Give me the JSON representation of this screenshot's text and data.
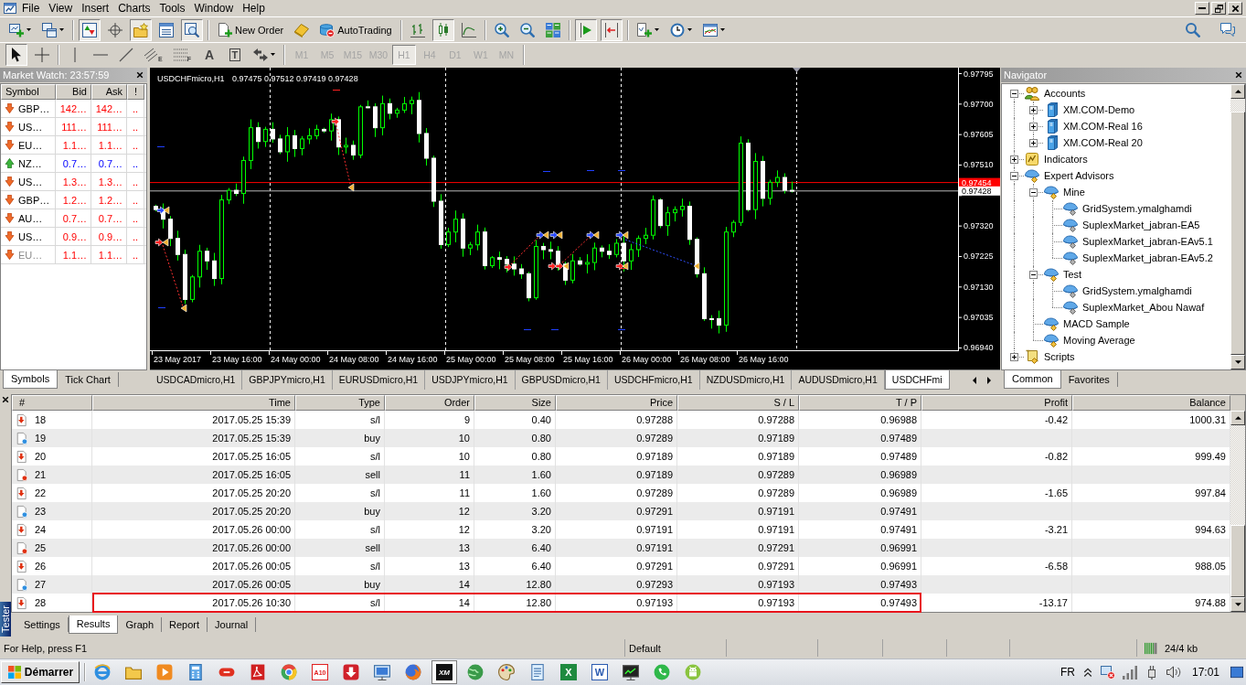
{
  "menu_bar": {
    "items": [
      "File",
      "View",
      "Insert",
      "Charts",
      "Tools",
      "Window",
      "Help"
    ]
  },
  "toolbar": {
    "groups": [
      [
        {
          "kind": "new-chart",
          "pressed": false
        },
        {
          "kind": "profiles",
          "pressed": false
        }
      ],
      [
        {
          "kind": "market-watch",
          "pressed": true
        },
        {
          "kind": "data-window",
          "pressed": false
        },
        {
          "kind": "navigator",
          "pressed": true
        },
        {
          "kind": "terminal",
          "pressed": false
        },
        {
          "kind": "tester",
          "pressed": true
        }
      ],
      [
        {
          "kind": "new-order",
          "label": "New Order",
          "pressed": false
        },
        {
          "kind": "editor",
          "pressed": false
        },
        {
          "kind": "autotrading",
          "label": "AutoTrading",
          "pressed": false
        }
      ],
      [
        {
          "kind": "bar-chart",
          "pressed": false
        },
        {
          "kind": "candle-chart",
          "pressed": true
        },
        {
          "kind": "line-chart",
          "pressed": false
        }
      ],
      [
        {
          "kind": "zoom-in",
          "pressed": false
        },
        {
          "kind": "zoom-out",
          "pressed": false
        },
        {
          "kind": "tile",
          "pressed": false
        }
      ],
      [
        {
          "kind": "auto-scroll",
          "pressed": true
        },
        {
          "kind": "chart-shift",
          "pressed": true
        }
      ],
      [
        {
          "kind": "indicators",
          "pressed": false
        },
        {
          "kind": "periods",
          "pressed": false
        },
        {
          "kind": "templates",
          "pressed": false
        }
      ]
    ]
  },
  "drawing_toolbar": {
    "tool_groups": [
      [
        {
          "kind": "cursor",
          "selected": true
        },
        {
          "kind": "crosshair",
          "selected": false
        }
      ],
      [
        {
          "kind": "vline",
          "selected": false
        },
        {
          "kind": "hline",
          "selected": false
        },
        {
          "kind": "trendline",
          "selected": false
        },
        {
          "kind": "channel",
          "mark": "E",
          "selected": false
        },
        {
          "kind": "fibo",
          "mark": "F",
          "selected": false
        },
        {
          "kind": "text",
          "label": "A",
          "selected": false
        },
        {
          "kind": "label",
          "label": "T",
          "selected": false
        },
        {
          "kind": "arrows",
          "selected": false
        }
      ]
    ],
    "timeframes": [
      {
        "label": "M1",
        "selected": false,
        "disabled": true
      },
      {
        "label": "M5",
        "selected": false,
        "disabled": true
      },
      {
        "label": "M15",
        "selected": false,
        "disabled": true
      },
      {
        "label": "M30",
        "selected": false,
        "disabled": true
      },
      {
        "label": "H1",
        "selected": true,
        "disabled": true
      },
      {
        "label": "H4",
        "selected": false,
        "disabled": true
      },
      {
        "label": "D1",
        "selected": false,
        "disabled": true
      },
      {
        "label": "W1",
        "selected": false,
        "disabled": true
      },
      {
        "label": "MN",
        "selected": false,
        "disabled": true
      }
    ]
  },
  "market_watch": {
    "title": "Market Watch: 23:57:59",
    "columns": [
      "Symbol",
      "Bid",
      "Ask",
      "!"
    ],
    "rows": [
      {
        "symbol": "GBP…",
        "bid": "142…",
        "ask": "142…",
        "extra": "..",
        "rising": false,
        "disabled": false
      },
      {
        "symbol": "US…",
        "bid": "111…",
        "ask": "111…",
        "extra": "..",
        "rising": false,
        "disabled": false
      },
      {
        "symbol": "EU…",
        "bid": "1.1…",
        "ask": "1.1…",
        "extra": "..",
        "rising": false,
        "disabled": false
      },
      {
        "symbol": "NZ…",
        "bid": "0.7…",
        "ask": "0.7…",
        "extra": "..",
        "rising": true,
        "disabled": false
      },
      {
        "symbol": "US…",
        "bid": "1.3…",
        "ask": "1.3…",
        "extra": "..",
        "rising": false,
        "disabled": false
      },
      {
        "symbol": "GBP…",
        "bid": "1.2…",
        "ask": "1.2…",
        "extra": "..",
        "rising": false,
        "disabled": false
      },
      {
        "symbol": "AU…",
        "bid": "0.7…",
        "ask": "0.7…",
        "extra": "..",
        "rising": false,
        "disabled": false
      },
      {
        "symbol": "US…",
        "bid": "0.9…",
        "ask": "0.9…",
        "extra": "..",
        "rising": false,
        "disabled": false
      },
      {
        "symbol": "EU…",
        "bid": "1.1…",
        "ask": "1.1…",
        "extra": "..",
        "rising": false,
        "disabled": true
      }
    ],
    "tabs": [
      {
        "label": "Symbols",
        "selected": true
      },
      {
        "label": "Tick Chart",
        "selected": false
      }
    ]
  },
  "chart": {
    "symbol": "USDCHFmicro,H1",
    "ohlc": "0.97475 0.97512 0.97419 0.97428",
    "price_scale": [
      "0.97795",
      "0.97700",
      "0.97605",
      "0.97510",
      "0.97320",
      "0.97225",
      "0.97130",
      "0.97035",
      "0.96940"
    ],
    "price_tags": [
      {
        "kind": "ask",
        "text": "0.97454"
      },
      {
        "kind": "bid",
        "text": "0.97428"
      }
    ],
    "time_scale": [
      "23 May 2017",
      "23 May 16:00",
      "24 May 00:00",
      "24 May 08:00",
      "24 May 16:00",
      "25 May 00:00",
      "25 May 08:00",
      "25 May 16:00",
      "26 May 00:00",
      "26 May 08:00",
      "26 May 16:00"
    ],
    "tabs": [
      {
        "label": "USDCADmicro,H1",
        "selected": false
      },
      {
        "label": "GBPJPYmicro,H1",
        "selected": false
      },
      {
        "label": "EURUSDmicro,H1",
        "selected": false
      },
      {
        "label": "USDJPYmicro,H1",
        "selected": false
      },
      {
        "label": "GBPUSDmicro,H1",
        "selected": false
      },
      {
        "label": "USDCHFmicro,H1",
        "selected": false
      },
      {
        "label": "NZDUSDmicro,H1",
        "selected": false
      },
      {
        "label": "AUDUSDmicro,H1",
        "selected": false
      },
      {
        "label": "USDCHFmi",
        "selected": true
      }
    ]
  },
  "navigator": {
    "title": "Navigator",
    "tree": [
      {
        "label": "Accounts",
        "kind": "accounts",
        "expanded": true,
        "children": [
          {
            "label": "XM.COM-Demo",
            "kind": "server",
            "expanded": false
          },
          {
            "label": "XM.COM-Real 16",
            "kind": "server",
            "expanded": false
          },
          {
            "label": "XM.COM-Real 20",
            "kind": "server",
            "expanded": false
          }
        ]
      },
      {
        "label": "Indicators",
        "kind": "indicators",
        "expanded": false
      },
      {
        "label": "Expert Advisors",
        "kind": "expert",
        "expanded": true,
        "children": [
          {
            "label": "Mine",
            "kind": "expert",
            "expanded": true,
            "children": [
              {
                "label": "GridSystem.ymalghamdi",
                "kind": "expert-file"
              },
              {
                "label": "SuplexMarket_jabran-EA5",
                "kind": "expert-file"
              },
              {
                "label": "SuplexMarket_jabran-EAv5.1",
                "kind": "expert-file"
              },
              {
                "label": "SuplexMarket_jabran-EAv5.2",
                "kind": "expert-file"
              }
            ]
          },
          {
            "label": "Test",
            "kind": "expert",
            "expanded": true,
            "children": [
              {
                "label": "GridSystem.ymalghamdi",
                "kind": "expert-file"
              },
              {
                "label": "SuplexMarket_Abou Nawaf",
                "kind": "expert-file"
              }
            ]
          },
          {
            "label": "MACD Sample",
            "kind": "expert"
          },
          {
            "label": "Moving Average",
            "kind": "expert"
          }
        ]
      },
      {
        "label": "Scripts",
        "kind": "scripts",
        "expanded": false
      }
    ],
    "tabs": [
      {
        "label": "Common",
        "selected": true
      },
      {
        "label": "Favorites",
        "selected": false
      }
    ]
  },
  "tester": {
    "title": "Tester",
    "columns": [
      "#",
      "Time",
      "Type",
      "Order",
      "Size",
      "Price",
      "S / L",
      "T / P",
      "Profit",
      "Balance"
    ],
    "rows": [
      {
        "kind": "sl",
        "num": "18",
        "time": "2017.05.25 15:39",
        "type": "s/l",
        "order": "9",
        "size": "0.40",
        "price": "0.97288",
        "sl": "0.97288",
        "tp": "0.96988",
        "profit": "-0.42",
        "balance": "1000.31",
        "highlighted": false
      },
      {
        "kind": "buy",
        "num": "19",
        "time": "2017.05.25 15:39",
        "type": "buy",
        "order": "10",
        "size": "0.80",
        "price": "0.97289",
        "sl": "0.97189",
        "tp": "0.97489",
        "highlighted": false
      },
      {
        "kind": "sl",
        "num": "20",
        "time": "2017.05.25 16:05",
        "type": "s/l",
        "order": "10",
        "size": "0.80",
        "price": "0.97189",
        "sl": "0.97189",
        "tp": "0.97489",
        "profit": "-0.82",
        "balance": "999.49",
        "highlighted": false
      },
      {
        "kind": "sell",
        "num": "21",
        "time": "2017.05.25 16:05",
        "type": "sell",
        "order": "11",
        "size": "1.60",
        "price": "0.97189",
        "sl": "0.97289",
        "tp": "0.96989",
        "highlighted": false
      },
      {
        "kind": "sl",
        "num": "22",
        "time": "2017.05.25 20:20",
        "type": "s/l",
        "order": "11",
        "size": "1.60",
        "price": "0.97289",
        "sl": "0.97289",
        "tp": "0.96989",
        "profit": "-1.65",
        "balance": "997.84",
        "highlighted": false
      },
      {
        "kind": "buy",
        "num": "23",
        "time": "2017.05.25 20:20",
        "type": "buy",
        "order": "12",
        "size": "3.20",
        "price": "0.97291",
        "sl": "0.97191",
        "tp": "0.97491",
        "highlighted": false
      },
      {
        "kind": "sl",
        "num": "24",
        "time": "2017.05.26 00:00",
        "type": "s/l",
        "order": "12",
        "size": "3.20",
        "price": "0.97191",
        "sl": "0.97191",
        "tp": "0.97491",
        "profit": "-3.21",
        "balance": "994.63",
        "highlighted": false
      },
      {
        "kind": "sell",
        "num": "25",
        "time": "2017.05.26 00:00",
        "type": "sell",
        "order": "13",
        "size": "6.40",
        "price": "0.97191",
        "sl": "0.97291",
        "tp": "0.96991",
        "highlighted": false
      },
      {
        "kind": "sl",
        "num": "26",
        "time": "2017.05.26 00:05",
        "type": "s/l",
        "order": "13",
        "size": "6.40",
        "price": "0.97291",
        "sl": "0.97291",
        "tp": "0.96991",
        "profit": "-6.58",
        "balance": "988.05",
        "highlighted": false
      },
      {
        "kind": "buy",
        "num": "27",
        "time": "2017.05.26 00:05",
        "type": "buy",
        "order": "14",
        "size": "12.80",
        "price": "0.97293",
        "sl": "0.97193",
        "tp": "0.97493",
        "highlighted": false
      },
      {
        "kind": "sl",
        "num": "28",
        "time": "2017.05.26 10:30",
        "type": "s/l",
        "order": "14",
        "size": "12.80",
        "price": "0.97193",
        "sl": "0.97193",
        "tp": "0.97493",
        "profit": "-13.17",
        "balance": "974.88",
        "highlighted": true
      }
    ],
    "tabs": [
      {
        "label": "Settings",
        "selected": false
      },
      {
        "label": "Results",
        "selected": true
      },
      {
        "label": "Graph",
        "selected": false
      },
      {
        "label": "Report",
        "selected": false
      },
      {
        "label": "Journal",
        "selected": false
      }
    ]
  },
  "status_bar": {
    "help": "For Help, press F1",
    "profile": "Default",
    "traffic": "24/4 kb"
  },
  "taskbar": {
    "start": "Démarrer",
    "apps": [
      {
        "kind": "ie",
        "selected": false
      },
      {
        "kind": "folder",
        "selected": false
      },
      {
        "kind": "media",
        "selected": false
      },
      {
        "kind": "calculator",
        "selected": false
      },
      {
        "kind": "capsule",
        "selected": false
      },
      {
        "kind": "pdf",
        "selected": false
      },
      {
        "kind": "chrome",
        "selected": false
      },
      {
        "kind": "a10",
        "label": "A10",
        "selected": false
      },
      {
        "kind": "download",
        "selected": false
      },
      {
        "kind": "remote",
        "selected": false
      },
      {
        "kind": "firefox",
        "selected": false
      },
      {
        "kind": "xm",
        "label": "XM",
        "selected": true
      },
      {
        "kind": "globe",
        "selected": false
      },
      {
        "kind": "paint",
        "selected": false
      },
      {
        "kind": "notepad",
        "selected": false
      },
      {
        "kind": "excel",
        "label": "X",
        "selected": false
      },
      {
        "kind": "word",
        "label": "W",
        "selected": false
      },
      {
        "kind": "monitor-chart",
        "selected": false
      },
      {
        "kind": "whatsapp",
        "selected": false
      },
      {
        "kind": "android",
        "selected": false
      }
    ],
    "language": "FR",
    "clock": "17:01"
  }
}
